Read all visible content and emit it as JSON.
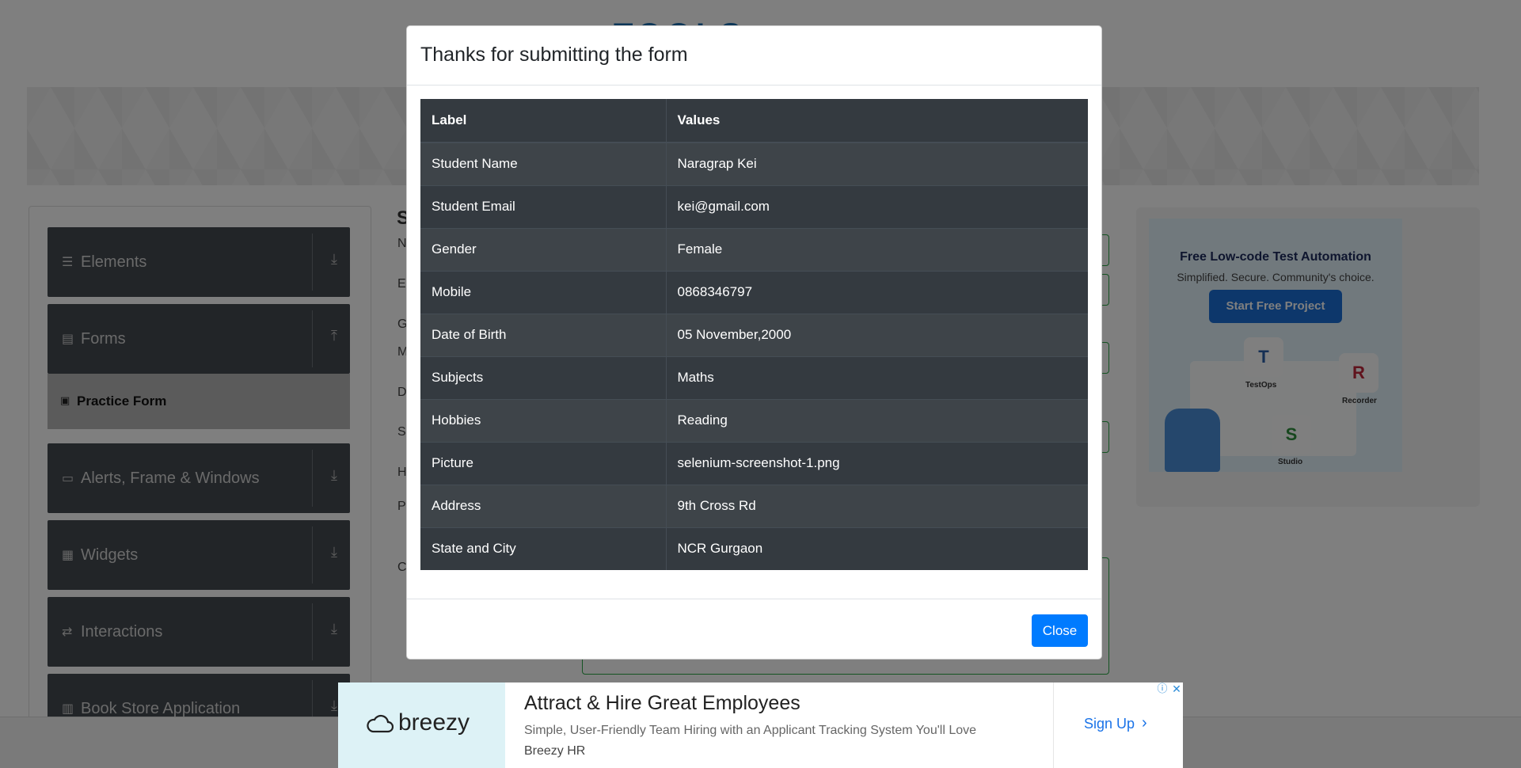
{
  "header": {
    "logo_text": "TOOLS"
  },
  "sidebar": {
    "items": [
      {
        "label": "Elements",
        "icon": "menu-icon",
        "arrow": "download-icon"
      },
      {
        "label": "Forms",
        "icon": "document-icon",
        "arrow": "upload-icon"
      },
      {
        "label": "Alerts, Frame & Windows",
        "icon": "window-icon",
        "arrow": "download-icon"
      },
      {
        "label": "Widgets",
        "icon": "widgets-icon",
        "arrow": "download-icon"
      },
      {
        "label": "Interactions",
        "icon": "interactions-icon",
        "arrow": "download-icon"
      },
      {
        "label": "Book Store Application",
        "icon": "books-icon",
        "arrow": "download-icon"
      }
    ],
    "active_sub_item": "Practice Form"
  },
  "form": {
    "title": "S",
    "letters": [
      "N",
      "E",
      "G",
      "M",
      "D",
      "S",
      "H",
      "P",
      "C"
    ]
  },
  "side_ad": {
    "title": "Free Low-code Test Automation",
    "subtitle": "Simplified. Secure. Community's choice.",
    "button": "Start Free Project",
    "cards": [
      {
        "letter": "T",
        "caption": "TestOps",
        "color": "#2b5fa8"
      },
      {
        "letter": "R",
        "caption": "Recorder",
        "color": "#c0263b"
      },
      {
        "letter": "S",
        "caption": "Studio",
        "color": "#2f8f3d"
      }
    ]
  },
  "modal": {
    "title": "Thanks for submitting the form",
    "table": {
      "headers": [
        "Label",
        "Values"
      ],
      "rows": [
        [
          "Student Name",
          "Naragrap Kei"
        ],
        [
          "Student Email",
          "kei@gmail.com"
        ],
        [
          "Gender",
          "Female"
        ],
        [
          "Mobile",
          "0868346797"
        ],
        [
          "Date of Birth",
          "05 November,2000"
        ],
        [
          "Subjects",
          "Maths"
        ],
        [
          "Hobbies",
          "Reading"
        ],
        [
          "Picture",
          "selenium-screenshot-1.png"
        ],
        [
          "Address",
          "9th Cross Rd"
        ],
        [
          "State and City",
          "NCR Gurgaon"
        ]
      ]
    },
    "close_label": "Close"
  },
  "bottom_ad": {
    "brand": "breezy",
    "headline": "Attract & Hire Great Employees",
    "description": "Simple, User-Friendly Team Hiring with an Applicant Tracking System You'll Love",
    "advertiser": "Breezy HR",
    "cta": "Sign Up"
  },
  "colors": {
    "modal_table_bg": "#343a40",
    "primary_button": "#007bff",
    "sidebar_bg": "#444a50",
    "overlay": "rgba(0,0,0,0.5)"
  }
}
